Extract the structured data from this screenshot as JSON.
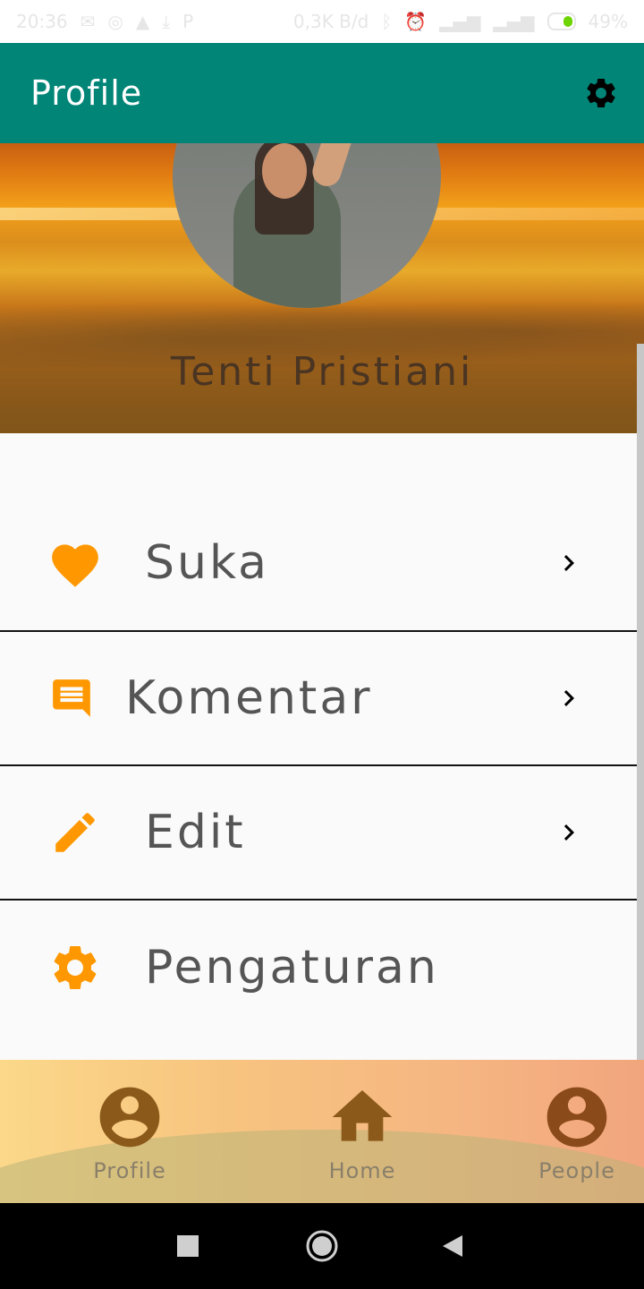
{
  "status_bar": {
    "time": "20:36",
    "net_speed": "0,3K B/d",
    "battery": "49%"
  },
  "app_bar": {
    "title": "Profile",
    "settings_icon": "gear-icon"
  },
  "profile": {
    "name": "Tenti Pristiani"
  },
  "menu": {
    "items": [
      {
        "label": "Suka",
        "icon": "heart-icon"
      },
      {
        "label": "Komentar",
        "icon": "comment-icon"
      },
      {
        "label": "Edit",
        "icon": "pencil-icon"
      },
      {
        "label": "Pengaturan",
        "icon": "gear-icon"
      }
    ]
  },
  "bottom_nav": {
    "items": [
      {
        "label": "Profile",
        "icon": "account-circle-icon"
      },
      {
        "label": "Home",
        "icon": "home-icon"
      },
      {
        "label": "People",
        "icon": "account-circle-icon"
      }
    ]
  },
  "colors": {
    "app_bar": "#008577",
    "accent": "#ff9800",
    "nav_icon": "#8b5a1a"
  }
}
